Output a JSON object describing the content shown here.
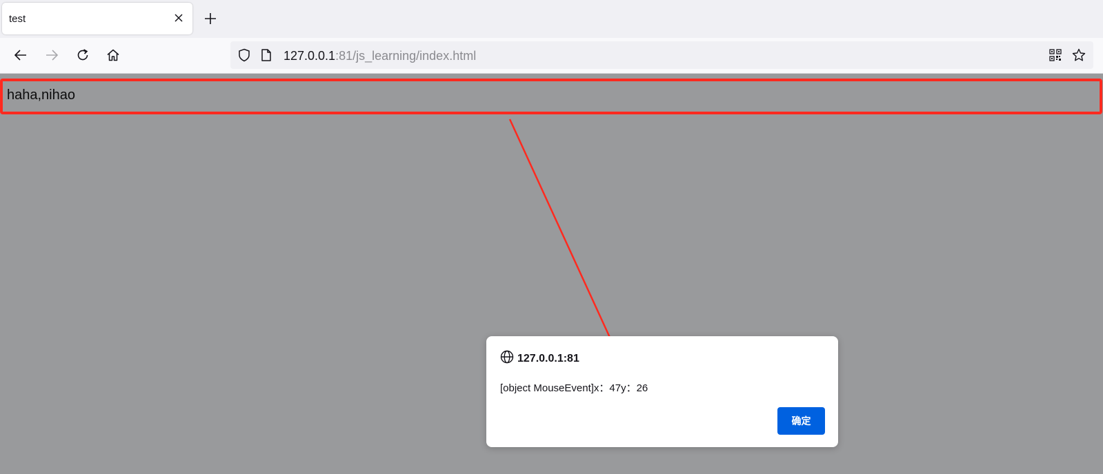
{
  "tab": {
    "title": "test"
  },
  "urlbar": {
    "host": "127.0.0.1",
    "rest": ":81/js_learning/index.html"
  },
  "page": {
    "text": "haha,nihao"
  },
  "dialog": {
    "origin": "127.0.0.1:81",
    "message": "[object MouseEvent]x：47y：26",
    "ok_label": "确定"
  },
  "colors": {
    "annotation": "#ff2a1f",
    "dialog_button": "#0061e0",
    "page_overlay": "#999a9c"
  },
  "icons": [
    "close-icon",
    "plus-icon",
    "back-icon",
    "forward-icon",
    "reload-icon",
    "home-icon",
    "shield-icon",
    "page-icon",
    "qr-code-icon",
    "star-icon",
    "globe-icon"
  ]
}
